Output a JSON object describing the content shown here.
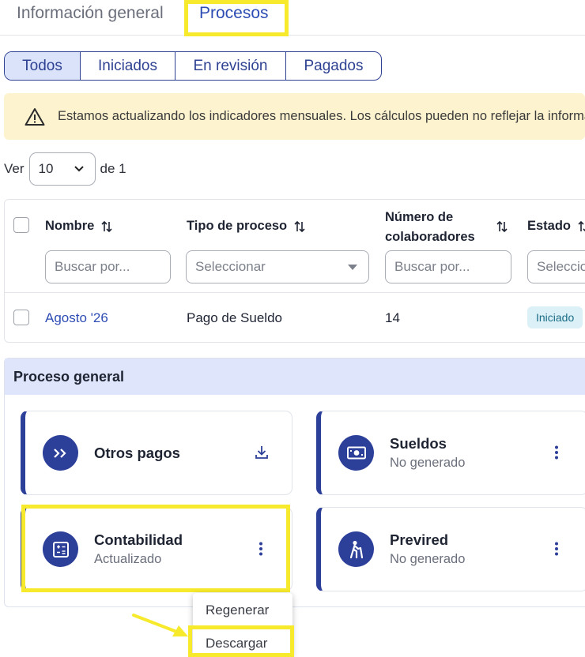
{
  "tabs": [
    {
      "label": "Información general"
    },
    {
      "label": "Procesos"
    }
  ],
  "filters": [
    {
      "label": "Todos"
    },
    {
      "label": "Iniciados"
    },
    {
      "label": "En revisión"
    },
    {
      "label": "Pagados"
    }
  ],
  "alert": {
    "icon": "warning-icon",
    "text": "Estamos actualizando los indicadores mensuales. Los cálculos pueden no reflejar la información"
  },
  "pager": {
    "prefix": "Ver",
    "page_size": "10",
    "suffix": "de 1"
  },
  "table": {
    "columns": [
      {
        "label": "Nombre"
      },
      {
        "label": "Tipo de proceso"
      },
      {
        "label": "Número de colaboradores"
      },
      {
        "label": "Estado"
      }
    ],
    "filters": [
      {
        "placeholder": "Buscar por..."
      },
      {
        "placeholder": "Seleccionar"
      },
      {
        "placeholder": "Buscar por..."
      },
      {
        "placeholder": "Seleccionar"
      }
    ],
    "rows": [
      {
        "name": "Agosto '26",
        "type": "Pago de Sueldo",
        "collaborators": "14",
        "status": "Iniciado"
      }
    ]
  },
  "panel": {
    "title": "Proceso general",
    "cards": [
      {
        "title": "Otros pagos",
        "subtitle": "",
        "icon": "fast-forward-icon",
        "action_icon": "download-icon"
      },
      {
        "title": "Sueldos",
        "subtitle": "No generado",
        "icon": "money-icon",
        "action_icon": "more-vertical-icon"
      },
      {
        "title": "Contabilidad",
        "subtitle": "Actualizado",
        "icon": "calculator-icon",
        "action_icon": "more-vertical-icon"
      },
      {
        "title": "Previred",
        "subtitle": "No generado",
        "icon": "elderly-person-icon",
        "action_icon": "more-vertical-icon"
      }
    ]
  },
  "context_menu": {
    "items": [
      {
        "label": "Regenerar"
      },
      {
        "label": "Descargar"
      }
    ]
  },
  "colors": {
    "primary": "#2c3f99",
    "link": "#2e4db4",
    "highlight": "#f7ea2c",
    "alert_bg": "#fdf3cf",
    "panel_header_bg": "#dfe6fb",
    "badge_bg": "#dcf0f7"
  }
}
